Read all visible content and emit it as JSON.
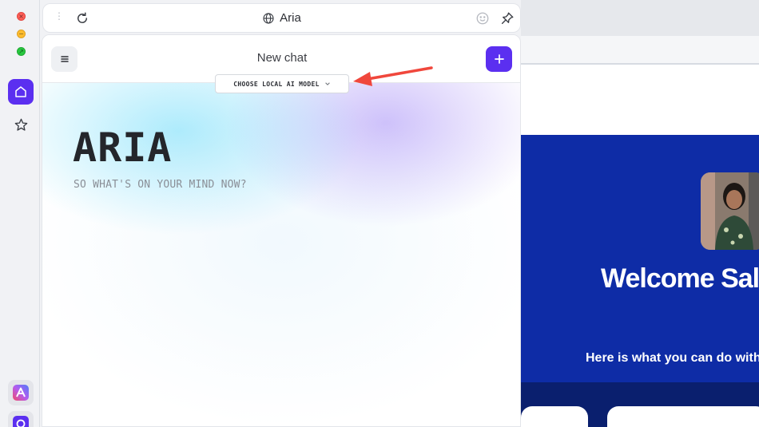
{
  "window": {
    "close_glyph": "×",
    "minimize_glyph": "−",
    "maximize_glyph": "↗"
  },
  "sidebar": {
    "items": [
      {
        "name": "home",
        "icon": "home-icon",
        "active": true
      },
      {
        "name": "favorites",
        "icon": "star-icon",
        "active": false
      }
    ],
    "apps": [
      {
        "icon": "aria-app-icon"
      },
      {
        "icon": "app-icon"
      }
    ],
    "accent": "#5b2ff0"
  },
  "toolbar": {
    "site_title": "Aria",
    "icons": [
      "grip-icon",
      "reload-icon",
      "globe-icon",
      "emoji-icon",
      "pin-icon"
    ],
    "grip_glyph": "⋮"
  },
  "chat": {
    "title": "New chat",
    "model_button_label": "CHOOSE LOCAL AI MODEL",
    "brand": "ARIA",
    "tagline": "SO WHAT'S ON YOUR MIND NOW?",
    "accent": "#5b2ff0"
  },
  "annotation": {
    "arrow_color": "#f0473c"
  },
  "background_page": {
    "heading": "Welcome Sal",
    "subtext": "Here is what you can do with",
    "colors": {
      "blue": "#0e2ca6",
      "navy": "#0a1f6e"
    }
  }
}
